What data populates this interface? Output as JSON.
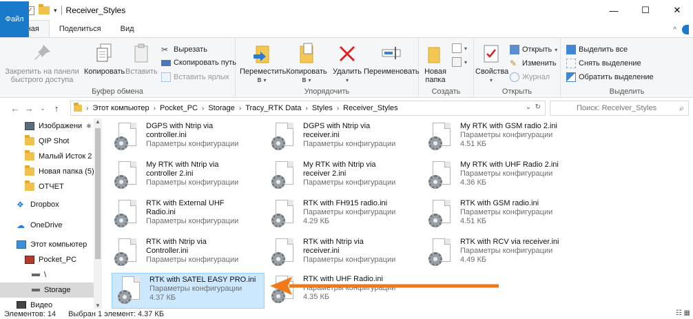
{
  "window": {
    "title": "Receiver_Styles",
    "controls": [
      "—",
      "☐",
      "✕"
    ]
  },
  "ribbon_tabs": [
    "Файл",
    "Главная",
    "Поделиться",
    "Вид"
  ],
  "ribbon": {
    "clipboard": {
      "pin_label": "Закрепить на панели быстрого доступа",
      "copy_label": "Копировать",
      "paste_label": "Вставить",
      "cut_label": "Вырезать",
      "copy_path_label": "Скопировать путь",
      "paste_shortcut_label": "Вставить ярлык",
      "group_label": "Буфер обмена"
    },
    "organize": {
      "move_label": "Переместить в",
      "copy_to_label": "Копировать в",
      "delete_label": "Удалить",
      "rename_label": "Переименовать",
      "group_label": "Упорядочить"
    },
    "create": {
      "new_folder_label": "Новая папка",
      "group_label": "Создать"
    },
    "open": {
      "properties_label": "Свойства",
      "open_label": "Открыть",
      "edit_label": "Изменить",
      "history_label": "Журнал",
      "group_label": "Открыть"
    },
    "select": {
      "select_all_label": "Выделить все",
      "select_none_label": "Снять выделение",
      "invert_label": "Обратить выделение",
      "group_label": "Выделить"
    }
  },
  "address": {
    "crumbs": [
      "Этот компьютер",
      "Pocket_PC",
      "Storage",
      "Tracy_RTK Data",
      "Styles",
      "Receiver_Styles"
    ],
    "search_placeholder": "Поиск: Receiver_Styles"
  },
  "nav_pane": {
    "items": [
      {
        "label": "Изображени",
        "icon": "pictures-icon"
      },
      {
        "label": "QIP Shot",
        "icon": "folder-icon"
      },
      {
        "label": "Малый Исток 2",
        "icon": "folder-icon"
      },
      {
        "label": "Новая папка (5)",
        "icon": "folder-icon"
      },
      {
        "label": "ОТЧЕТ",
        "icon": "folder-icon"
      },
      {
        "label": "Dropbox",
        "icon": "dropbox-icon"
      },
      {
        "label": "OneDrive",
        "icon": "onedrive-icon"
      },
      {
        "label": "Этот компьютер",
        "icon": "computer-icon"
      },
      {
        "label": "Pocket_PC",
        "icon": "device-icon"
      },
      {
        "label": "\\",
        "icon": "drive-icon"
      },
      {
        "label": "Storage",
        "icon": "drive-icon"
      },
      {
        "label": "Видео",
        "icon": "video-icon"
      }
    ]
  },
  "files": [
    {
      "name1": "DGPS with Ntrip via",
      "name2": "controller.ini",
      "type": "Параметры конфигурации",
      "size": ""
    },
    {
      "name1": "DGPS with Ntrip via",
      "name2": "receiver.ini",
      "type": "Параметры конфигурации",
      "size": ""
    },
    {
      "name1": "My RTK with GSM radio 2.ini",
      "name2": "",
      "type": "Параметры конфигурации",
      "size": "4.51 КБ"
    },
    {
      "name1": "My RTK with Ntrip via",
      "name2": "controller 2.ini",
      "type": "Параметры конфигурации",
      "size": ""
    },
    {
      "name1": "My RTK with Ntrip via",
      "name2": "receiver 2.ini",
      "type": "Параметры конфигурации",
      "size": ""
    },
    {
      "name1": "My RTK with UHF Radio 2.ini",
      "name2": "",
      "type": "Параметры конфигурации",
      "size": "4.36 КБ"
    },
    {
      "name1": "RTK with External UHF",
      "name2": "Radio.ini",
      "type": "Параметры конфигурации",
      "size": ""
    },
    {
      "name1": "RTK with FH915 radio.ini",
      "name2": "",
      "type": "Параметры конфигурации",
      "size": "4.29 КБ"
    },
    {
      "name1": "RTK with GSM radio.ini",
      "name2": "",
      "type": "Параметры конфигурации",
      "size": "4.51 КБ"
    },
    {
      "name1": "RTK with Ntrip via",
      "name2": "Controller.ini",
      "type": "Параметры конфигурации",
      "size": ""
    },
    {
      "name1": "RTK with Ntrip via",
      "name2": "receiver.ini",
      "type": "Параметры конфигурации",
      "size": ""
    },
    {
      "name1": "RTK with RCV via receiver.ini",
      "name2": "",
      "type": "Параметры конфигурации",
      "size": "4.49 КБ"
    },
    {
      "name1": "RTK with SATEL EASY PRO.ini",
      "name2": "",
      "type": "Параметры конфигурации",
      "size": "4.37 КБ"
    },
    {
      "name1": "RTK with UHF Radio.ini",
      "name2": "",
      "type": "Параметры конфигурации",
      "size": "4.35 КБ"
    }
  ],
  "selected_file_index": 12,
  "status": {
    "count": "Элементов: 14",
    "selection": "Выбран 1 элемент: 4.37 КБ"
  },
  "colors": {
    "accent": "#1979ca",
    "selection_bg": "#cce8ff",
    "arrow": "#f07a1a"
  }
}
